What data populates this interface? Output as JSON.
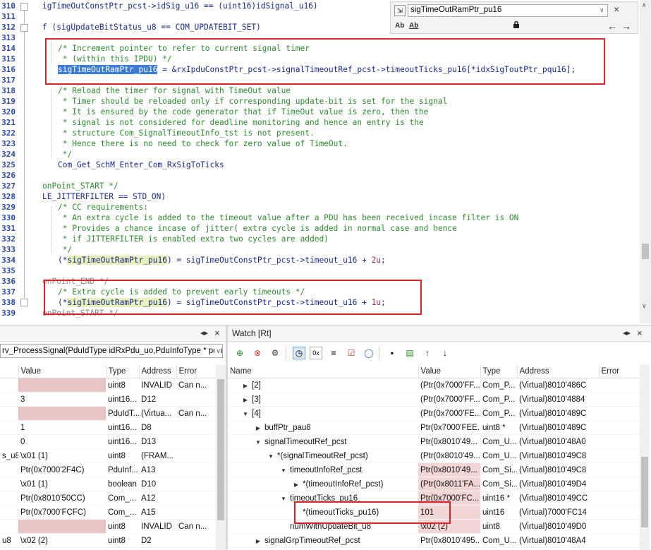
{
  "editor": {
    "line_numbers": [
      "310",
      "311",
      "312",
      "313",
      "314",
      "315",
      "316",
      "317",
      "318",
      "319",
      "320",
      "321",
      "322",
      "323",
      "324",
      "325",
      "326",
      "327",
      "328",
      "329",
      "330",
      "331",
      "332",
      "333",
      "334",
      "335",
      "336",
      "337",
      "338",
      "339"
    ],
    "lines": {
      "l310": "igTimeOutConstPtr_pcst->idSig_u16 == (uint16)idSignal_u16)",
      "l312": "f (sigUpdateBitStatus_u8 == COM_UPDATEBIT_SET)",
      "l314": "/* Increment pointer to refer to current signal timer",
      "l315": " * (within this IPDU) */",
      "l316_sel": "sigTimeOutRamPtr_pu16",
      "l316_rest": " = &rxIpduConstPtr_pcst->signalTimeoutRef_pcst->timeoutTicks_pu16[*idxSigToutPtr_pqu16];",
      "l318": "/* Reload the timer for signal with TimeOut value",
      "l319": " * Timer should be reloaded only if corresponding update-bit is set for the signal",
      "l320": " * It is ensured by the code generator that if TimeOut value is zero, then the",
      "l321": " * signal is not considered for deadline monitoring and hence an entry is the",
      "l322": " * structure Com_SignalTimeoutInfo_tst is not present.",
      "l323": " * Hence there is no need to check for zero value of TimeOut.",
      "l324": " */",
      "l325": "Com_Get_SchM_Enter_Com_RxSigToTicks",
      "l327": "onPoint_START */",
      "l328": "LE_JITTERFILTER == STD_ON)",
      "l329": "/* CC requirements:",
      "l330": " * An extra cycle is added to the timeout value after a PDU has been received incase filter is ON",
      "l331": " * Provides a chance incase of jitter( extra cycle is added in normal case and hence",
      "l332": " * if JITTERFILTER is enabled extra two cycles are added)",
      "l333": " */",
      "l334_a": "(*",
      "l334_b": "sigTimeOutRamPtr_pu16",
      "l334_c": ") = sigTimeOutConstPtr_pcst->timeout_u16 + ",
      "l334_num": "2u",
      "l336": "onPoint_END */",
      "l337": "/* Extra cycle is added to prevent early timeouts */",
      "l338_a": "(*",
      "l338_b": "sigTimeOutRamPtr_pu16",
      "l338_c": ") = sigTimeOutConstPtr_pcst->timeout_u16 + ",
      "l338_num": "1u",
      "l339": "onPoint_START */"
    }
  },
  "find": {
    "value": "sigTimeOutRamPtr_pu16",
    "opt1": "Ab",
    "opt2": "Ab"
  },
  "left_pane": {
    "combo": "rv_ProcessSignal(PduIdType idRxPdu_uo,PduInfoType * pdu",
    "columns": [
      "Value",
      "Type",
      "Address",
      "Error"
    ],
    "rows": [
      {
        "name": "",
        "value": "",
        "type": "uint8",
        "address": "INVALID",
        "error": "Can n...",
        "inv": true
      },
      {
        "name": "",
        "value": "3",
        "type": "uint16...",
        "address": "D12",
        "error": ""
      },
      {
        "name": "",
        "value": "",
        "type": "PduIdT...",
        "address": "(Virtua...",
        "error": "Can n...",
        "inv": true
      },
      {
        "name": "",
        "value": "1",
        "type": "uint16...",
        "address": "D8",
        "error": ""
      },
      {
        "name": "",
        "value": "0",
        "type": "uint16...",
        "address": "D13",
        "error": ""
      },
      {
        "name": "s_u8",
        "value": "\\x01 (1)",
        "type": "uint8",
        "address": "(FRAM...",
        "error": ""
      },
      {
        "name": "",
        "value": "Ptr(0x7000'2F4C)",
        "type": "PduInf...",
        "address": "A13",
        "error": ""
      },
      {
        "name": "",
        "value": "\\x01 (1)",
        "type": "boolean",
        "address": "D10",
        "error": ""
      },
      {
        "name": "",
        "value": "Ptr(0x8010'50CC)",
        "type": "Com_...",
        "address": "A12",
        "error": "",
        "sel": true
      },
      {
        "name": "",
        "value": "Ptr(0x7000'FCFC)",
        "type": "Com_...",
        "address": "A15",
        "error": ""
      },
      {
        "name": "",
        "value": "",
        "type": "uint8",
        "address": "INVALID",
        "error": "Can n...",
        "inv": true
      },
      {
        "name": "u8",
        "value": "\\x02 (2)",
        "type": "uint8",
        "address": "D2",
        "error": ""
      }
    ]
  },
  "watch": {
    "title": "Watch [Rt]",
    "columns": [
      "Name",
      "Value",
      "Type",
      "Address",
      "Error"
    ],
    "rows": [
      {
        "indent": 20,
        "tw": "right",
        "name": "[2]",
        "value": "(Ptr(0x7000'FF...",
        "type": "Com_P...",
        "address": "(Virtual)8010'486C"
      },
      {
        "indent": 20,
        "tw": "right",
        "name": "[3]",
        "value": "(Ptr(0x7000'FF...",
        "type": "Com_P...",
        "address": "(Virtual)8010'4884"
      },
      {
        "indent": 20,
        "tw": "down",
        "name": "[4]",
        "value": "(Ptr(0x7000'FE...",
        "type": "Com_P...",
        "address": "(Virtual)8010'489C"
      },
      {
        "indent": 38,
        "tw": "right",
        "name": "buffPtr_pau8",
        "value": "Ptr(0x7000'FEE...",
        "type": "uint8 *",
        "address": "(Virtual)8010'489C"
      },
      {
        "indent": 38,
        "tw": "down",
        "name": "signalTimeoutRef_pcst",
        "value": "Ptr(0x8010'49...",
        "type": "Com_U...",
        "address": "(Virtual)8010'48A0"
      },
      {
        "indent": 56,
        "tw": "down",
        "name": "*(signalTimeoutRef_pcst)",
        "value": "(Ptr(0x8010'49...",
        "type": "Com_U...",
        "address": "(Virtual)8010'49C8"
      },
      {
        "indent": 74,
        "tw": "down",
        "name": "timeoutInfoRef_pcst",
        "value": "Ptr(0x8010'49...",
        "type": "Com_Si...",
        "address": "(Virtual)8010'49C8",
        "red": true
      },
      {
        "indent": 92,
        "tw": "right",
        "name": "*(timeoutInfoRef_pcst)",
        "value": "(Ptr(0x8011'FA...",
        "type": "Com_Si...",
        "address": "(Virtual)8010'49D4",
        "red": true
      },
      {
        "indent": 74,
        "tw": "down",
        "name": "timeoutTicks_pu16",
        "value": "Ptr(0x7000'FC...",
        "type": "uint16 *",
        "address": "(Virtual)8010'49CC",
        "red": true
      },
      {
        "indent": 92,
        "tw": "",
        "name": "*(timeoutTicks_pu16)",
        "value": "101",
        "type": "uint16",
        "address": "(Virtual)7000'FC14",
        "red": true,
        "sel": true
      },
      {
        "indent": 74,
        "tw": "",
        "name": "numWithUpdateBit_u8",
        "value": "\\x02 (2)",
        "type": "uint8",
        "address": "(Virtual)8010'49D0",
        "red": true
      },
      {
        "indent": 38,
        "tw": "right",
        "name": "signalGrpTimeoutRef_pcst",
        "value": "Ptr(0x8010'495...",
        "type": "Com_U...",
        "address": "(Virtual)8010'48A4"
      }
    ]
  },
  "colors": {
    "highlight_red": "#d8232a",
    "selection_blue": "#3a7bd5",
    "comment_green": "#2e8b2e"
  }
}
